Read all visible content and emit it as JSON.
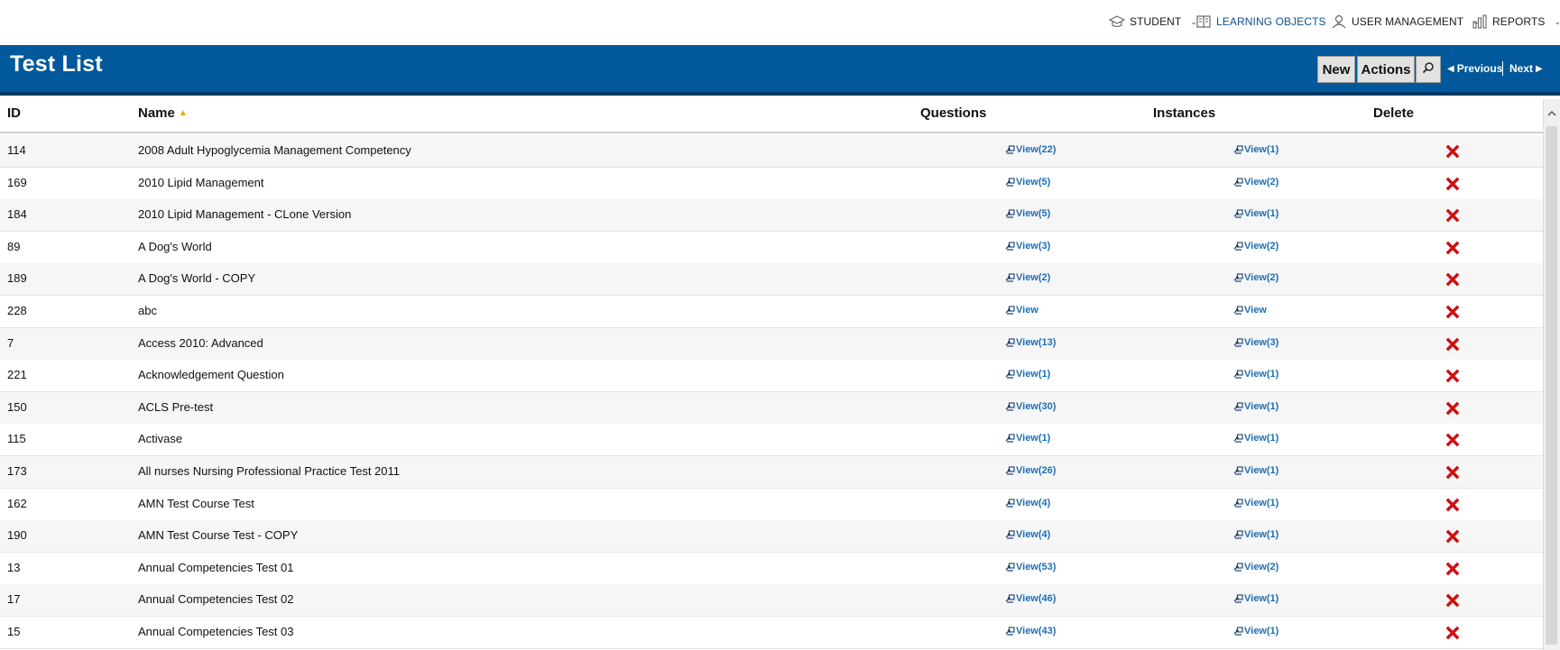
{
  "nav": {
    "items": [
      {
        "label": "STUDENT",
        "icon": "graduation-cap-icon"
      },
      {
        "label": "LEARNING OBJECTS",
        "icon": "book-icon"
      },
      {
        "label": "USER MANAGEMENT",
        "icon": "user-icon"
      },
      {
        "label": "REPORTS",
        "icon": "bar-chart-icon"
      }
    ],
    "active_index": 1,
    "active_color": "#0d4f8c"
  },
  "titlebar": {
    "title": "Test List",
    "new_label": "New",
    "actions_label": "Actions",
    "search_icon": "search-icon",
    "previous_label": "Previous",
    "next_label": "Next",
    "background": "#01589a"
  },
  "table": {
    "headers": {
      "id": "ID",
      "name": "Name",
      "questions": "Questions",
      "instances": "Instances",
      "delete": "Delete"
    },
    "sorted_column": "name",
    "sort_direction": "ascending",
    "rows": [
      {
        "id": "114",
        "name": "2008 Adult Hypoglycemia Management Competency",
        "questions": "View(22)",
        "instances": "View(1)"
      },
      {
        "id": "169",
        "name": "2010 Lipid Management",
        "questions": "View(5)",
        "instances": "View(2)"
      },
      {
        "id": "184",
        "name": "2010 Lipid Management - CLone Version",
        "questions": "View(5)",
        "instances": "View(1)"
      },
      {
        "id": "89",
        "name": "A Dog's World",
        "questions": "View(3)",
        "instances": "View(2)"
      },
      {
        "id": "189",
        "name": "A Dog's World - COPY",
        "questions": "View(2)",
        "instances": "View(2)"
      },
      {
        "id": "228",
        "name": "abc",
        "questions": "View",
        "instances": "View"
      },
      {
        "id": "7",
        "name": "Access 2010: Advanced",
        "questions": "View(13)",
        "instances": "View(3)"
      },
      {
        "id": "221",
        "name": "Acknowledgement Question",
        "questions": "View(1)",
        "instances": "View(1)"
      },
      {
        "id": "150",
        "name": "ACLS Pre-test",
        "questions": "View(30)",
        "instances": "View(1)"
      },
      {
        "id": "115",
        "name": "Activase",
        "questions": "View(1)",
        "instances": "View(1)"
      },
      {
        "id": "173",
        "name": "All nurses Nursing Professional Practice Test 2011",
        "questions": "View(26)",
        "instances": "View(1)"
      },
      {
        "id": "162",
        "name": "AMN Test Course Test",
        "questions": "View(4)",
        "instances": "View(1)"
      },
      {
        "id": "190",
        "name": "AMN Test Course Test - COPY",
        "questions": "View(4)",
        "instances": "View(1)"
      },
      {
        "id": "13",
        "name": "Annual Competencies Test 01",
        "questions": "View(53)",
        "instances": "View(2)"
      },
      {
        "id": "17",
        "name": "Annual Competencies Test 02",
        "questions": "View(46)",
        "instances": "View(1)"
      },
      {
        "id": "15",
        "name": "Annual Competencies Test 03",
        "questions": "View(43)",
        "instances": "View(1)"
      }
    ],
    "link_color": "#1f6fb3",
    "delete_color": "#cc1111"
  }
}
